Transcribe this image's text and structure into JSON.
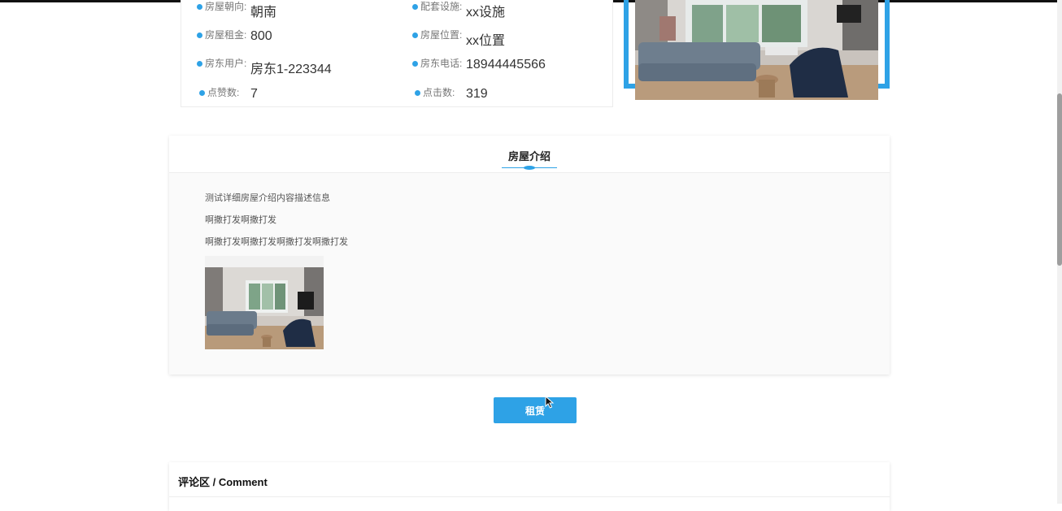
{
  "house_info": {
    "rows": [
      {
        "left_label": "房屋朝向:",
        "left_value": "朝南",
        "right_label": "配套设施:",
        "right_value": "xx设施"
      },
      {
        "left_label": "房屋租金:",
        "left_value": "800",
        "right_label": "房屋位置:",
        "right_value": "xx位置"
      },
      {
        "left_label": "房东用户:",
        "left_value": "房东1-223344",
        "right_label": "房东电话:",
        "right_value": "18944445566"
      },
      {
        "left_label": "点赞数:",
        "left_value": "7",
        "right_label": "点击数:",
        "right_value": "319"
      }
    ]
  },
  "intro": {
    "title": "房屋介绍",
    "lines": [
      "测试详细房屋介绍内容描述信息",
      "啊撒打发啊撒打发",
      "啊撒打发啊撒打发啊撒打发啊撒打发"
    ]
  },
  "actions": {
    "rent_label": "租赁"
  },
  "comments": {
    "title": "评论区 / Comment"
  },
  "colors": {
    "accent": "#2ea2e6"
  }
}
